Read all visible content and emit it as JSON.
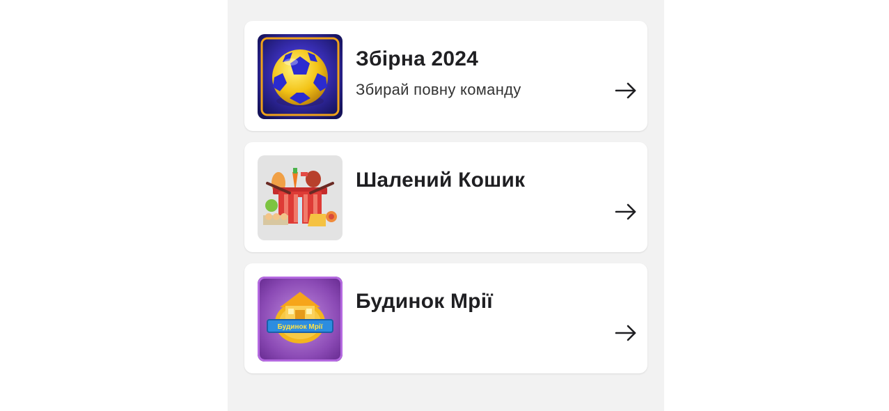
{
  "colors": {
    "page_background": "#ffffff",
    "column_background": "#f2f2f2",
    "card_background": "#ffffff",
    "text": "#1f1f22"
  },
  "games": [
    {
      "title": "Збірна 2024",
      "subtitle": "Збирай повну команду",
      "icon": "soccer-ball-icon"
    },
    {
      "title": "Шалений Кошик",
      "subtitle": "",
      "icon": "grocery-basket-icon"
    },
    {
      "title": "Будинок Мрії",
      "subtitle": "",
      "icon": "dream-house-logo",
      "logo_text": "Будинок Мрії"
    }
  ]
}
